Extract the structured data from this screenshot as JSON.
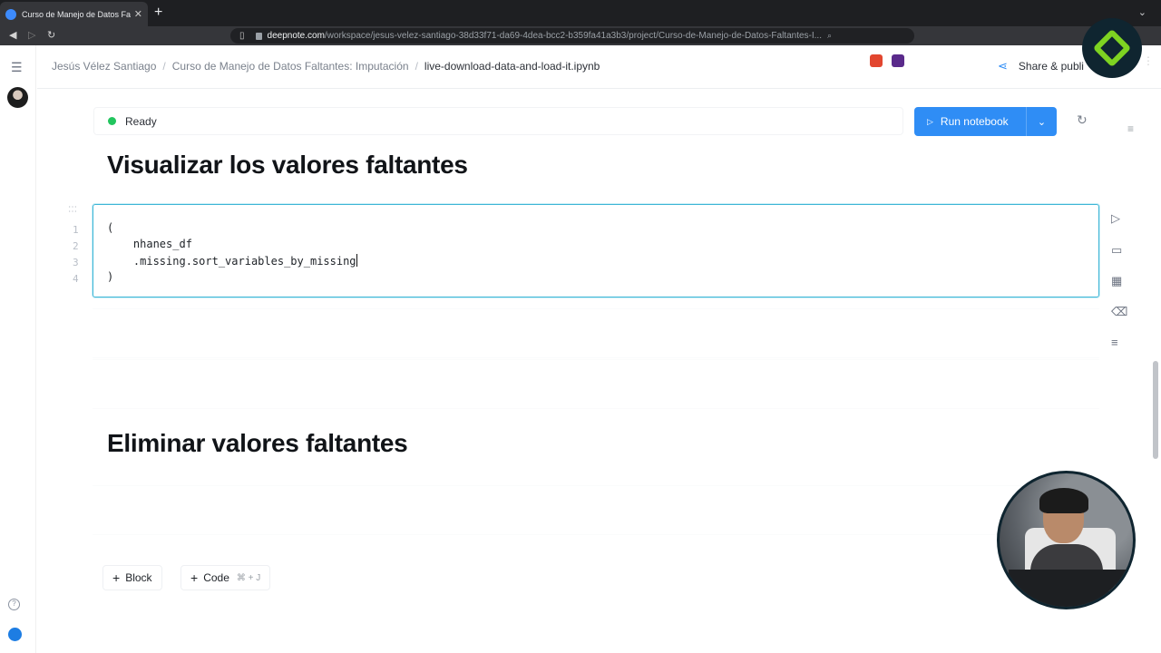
{
  "browser": {
    "tab_title": "Curso de Manejo de Datos Falta",
    "url_host": "deepnote.com",
    "url_path": "/workspace/jesus-velez-santiago-38d33f71-da69-4dea-bcc2-b359fa41a3b3/project/Curso-de-Manejo-de-Datos-Faltantes-I..."
  },
  "header": {
    "breadcrumbs": [
      "Jesús Vélez Santiago",
      "Curso de Manejo de Datos Faltantes: Imputación",
      "live-download-data-and-load-it.ipynb"
    ],
    "share_label": "Share & publi"
  },
  "status": {
    "text": "Ready",
    "color": "#22c55e"
  },
  "run_button": {
    "label": "Run notebook",
    "color": "#2f8df5"
  },
  "blocks": {
    "title_1": "Visualizar los valores faltantes",
    "title_2": "Eliminar valores faltantes"
  },
  "code_cell": {
    "line_numbers": [
      "1",
      "2",
      "3",
      "4"
    ],
    "lines": [
      "(",
      "    nhanes_df",
      "    .missing.sort_variables_by_missing",
      ")"
    ]
  },
  "add_buttons": {
    "block_label": "Block",
    "code_label": "Code",
    "code_shortcut": "⌘ + J"
  },
  "icons": {
    "sidebar_toggle": "list-icon",
    "help": "help-circle-icon",
    "cell_actions": [
      "play-icon",
      "comment-icon",
      "calendar-icon",
      "trash-icon",
      "menu-icon"
    ]
  }
}
